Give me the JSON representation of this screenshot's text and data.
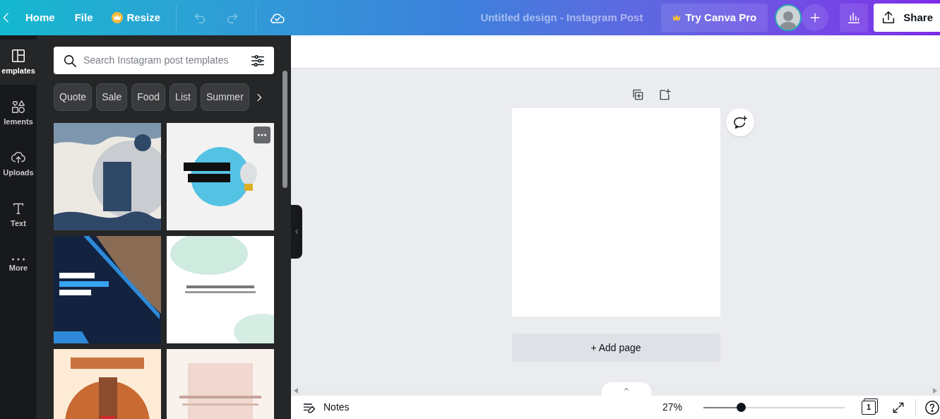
{
  "topbar": {
    "nav": [
      {
        "kind": "back"
      },
      {
        "kind": "menu",
        "label": "Home"
      },
      {
        "kind": "menu",
        "label": "File"
      },
      {
        "kind": "premium",
        "label": "Resize"
      }
    ],
    "history": [
      {
        "kind": "undo",
        "disabled": true
      },
      {
        "kind": "redo",
        "disabled": true
      }
    ],
    "design_title": "Untitled design - Instagram Post",
    "pro_button": "Try Canva Pro",
    "share_button": "Share"
  },
  "sidebar": {
    "items": [
      {
        "kind": "templates",
        "label": "emplates",
        "selected": true
      },
      {
        "kind": "elements",
        "label": "lements",
        "selected": false
      },
      {
        "kind": "uploads",
        "label": "Uploads",
        "selected": false
      },
      {
        "kind": "text",
        "label": "Text",
        "selected": false
      },
      {
        "kind": "more",
        "label": "More",
        "selected": false
      }
    ]
  },
  "panel": {
    "search": {
      "placeholder": "Search Instagram post templates"
    },
    "chips": [
      "Quote",
      "Sale",
      "Food",
      "List",
      "Summer"
    ],
    "templates": [
      {
        "hovered": false
      },
      {
        "hovered": true
      },
      {
        "hovered": false
      },
      {
        "hovered": false
      },
      {
        "hovered": false
      },
      {
        "hovered": false
      }
    ]
  },
  "canvas": {
    "add_page": "+ Add page"
  },
  "footer": {
    "notes": "Notes",
    "zoom": "27%",
    "zoom_slider": {
      "level": 0.25
    },
    "page_count": "1"
  }
}
